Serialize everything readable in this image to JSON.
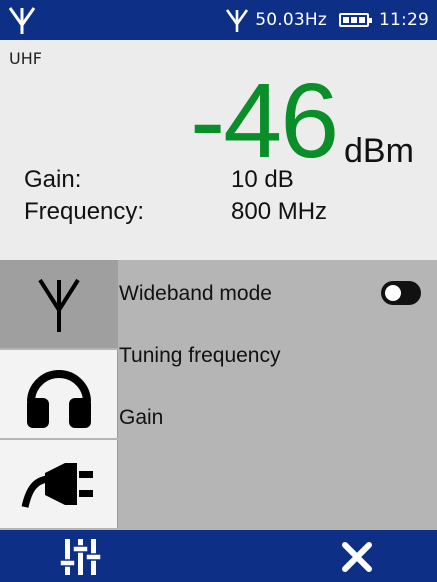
{
  "status": {
    "frequency": "50.03Hz",
    "time": "11:29",
    "icons": [
      "antenna-icon",
      "antenna-icon",
      "battery-icon"
    ]
  },
  "measurement": {
    "band": "UHF",
    "value": "-46",
    "unit": "dBm",
    "gain_label": "Gain:",
    "gain_value": "10 dB",
    "frequency_label": "Frequency:",
    "frequency_value": "800 MHz",
    "value_color": "#0a8e2a"
  },
  "panel": {
    "tabs": [
      {
        "icon": "antenna-icon",
        "active": true
      },
      {
        "icon": "headphones-icon",
        "active": false
      },
      {
        "icon": "power-plug-icon",
        "active": false
      }
    ],
    "items": [
      {
        "label": "Wideband mode",
        "control": "toggle"
      },
      {
        "label": "Tuning frequency"
      },
      {
        "label": "Gain"
      }
    ]
  },
  "bottom": {
    "icons": [
      "equalizer-icon",
      "close-icon"
    ]
  },
  "colors": {
    "bar": "#0d2f86",
    "panel": "#b5b5b5",
    "background": "#ececec"
  }
}
